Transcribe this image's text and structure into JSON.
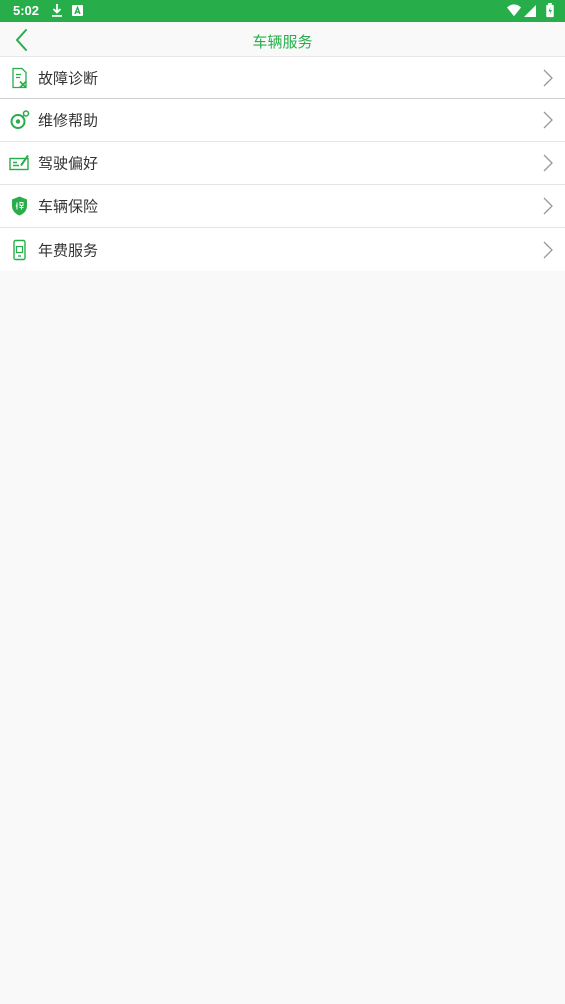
{
  "status_bar": {
    "time": "5:02",
    "icons": [
      "download-icon",
      "a-icon",
      "wifi-icon",
      "signal-icon",
      "battery-icon"
    ]
  },
  "header": {
    "title": "车辆服务",
    "back_icon": "chevron-left-icon"
  },
  "menu": {
    "items": [
      {
        "label": "故障诊断",
        "icon": "diagnosis-icon"
      },
      {
        "label": "维修帮助",
        "icon": "repair-icon"
      },
      {
        "label": "驾驶偏好",
        "icon": "driving-preference-icon"
      },
      {
        "label": "车辆保险",
        "icon": "insurance-shield-icon"
      },
      {
        "label": "年费服务",
        "icon": "annual-fee-icon"
      }
    ]
  },
  "colors": {
    "accent": "#27ae4a",
    "background": "#f9f9f9",
    "text": "#333333"
  }
}
